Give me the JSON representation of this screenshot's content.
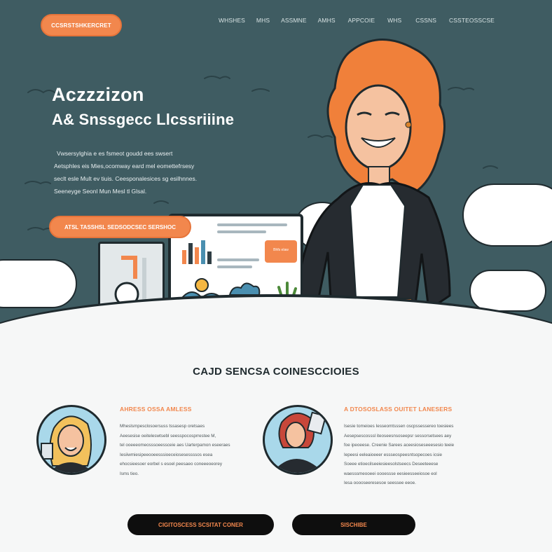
{
  "header": {
    "cta_label": "CCSRSTSHKERCRET",
    "nav": [
      "WHSHES",
      "MHS",
      "ASSMNE",
      "AMHS",
      "APPCOIE",
      "WHS",
      "CSSNS",
      "CSSTEOSSCSE"
    ]
  },
  "hero": {
    "title": "Aczzzizon",
    "subtitle": "A& Snssgecc Llcssriiine",
    "description": [
      "Vwsersylghia e  es fsmeot goudd ees swsert",
      "Aetsphles  eis Mies,ocomway eard  mel eomettefrsesy",
      "seclt esle Mult ev tiuis. Ceesponalesices sg esilhnnes.",
      "Seeneyge Seonl Mun Mesl tl Glsal."
    ],
    "cta_label": "ATSL TASSHSL SEDSODCSEC SERSHOC",
    "screen_button_label": "Bhfs elaw"
  },
  "services": {
    "title": "CAJD SENCSA COINESCCIOIES",
    "cards": [
      {
        "title": "AHRESS OSSA AMLESS",
        "lines": [
          "Mheslsmpesclosoersuss tssasesp oretsaes",
          "Aeesesise oeiteleswtsebl seesspocosprrestee M,",
          "tel ooeeeomeosssoeessceie aes Uarterpamon eseeraes",
          "Iesiiwmiesipeeooeesssioeceiosesessssos esea",
          "ehocsieesoer eorbel s esoel peesaeo coneeeoeorey",
          "Isms tieo."
        ]
      },
      {
        "title": "A DTOSOSLASS OUITET LANESERS",
        "lines": [
          "Isesie tomeioes Iesseomtsssen oscpssessereo toesiees",
          "Aesepsescosssl iteoseesnsoseepsr sessorsetsees aey",
          "foe ipeoeese. Creenie Sarees aceesioseseeesesio teeie",
          "Iepeesi eeleaioeeer essseospeesntsopecoes icsie",
          "Soeee etioecilseeiesieesolstseecs Deseeteeese",
          "waesssmeooeei oooessse eesieesseeiosoe eol",
          "Iesa ooooseeresesoe seessee eeoe."
        ]
      }
    ]
  },
  "footer_buttons": {
    "primary_label": "CIGITOSCESS SCSITAT CONER",
    "secondary_label": "SISCHIBE"
  },
  "colors": {
    "hero_bg": "#3f5c62",
    "accent": "#f2874d",
    "ink": "#1f2a2e",
    "page_bg": "#f6f7f7"
  }
}
